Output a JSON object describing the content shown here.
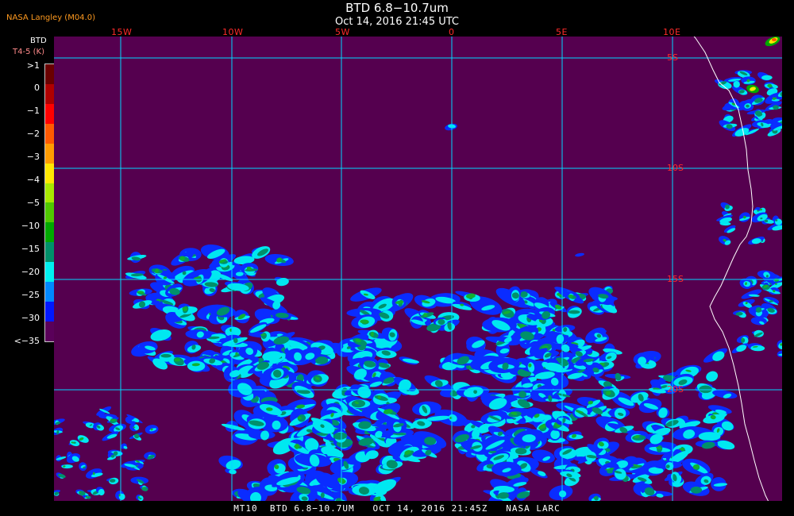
{
  "header": {
    "title": "BTD 6.8−10.7um",
    "subtitle": "Oct 14, 2016 21:45 UTC",
    "agency": "NASA Langley (M04.0)"
  },
  "colorbar": {
    "title_line1": "BTD",
    "title_line2": "T4-5 (K)",
    "labels": [
      ">1",
      "0",
      "−1",
      "−2",
      "−3",
      "−4",
      "−5",
      "−10",
      "−15",
      "−20",
      "−25",
      "−30",
      "<−35"
    ],
    "colors": [
      "#6a0000",
      "#b00000",
      "#ff0000",
      "#ff5a00",
      "#ff9c00",
      "#ffe800",
      "#a8e800",
      "#50c800",
      "#00a800",
      "#00906a",
      "#00f0f0",
      "#0088ff",
      "#0018ff",
      "#5a005a"
    ]
  },
  "map": {
    "background": "#55004f",
    "grid_color": "#00d8ff",
    "lon_labels": [
      "15W",
      "10W",
      "5W",
      "0",
      "5E",
      "10E"
    ],
    "lat_labels": [
      "5S",
      "10S",
      "15S",
      "20S"
    ],
    "lon_range": [
      -18,
      14.8
    ],
    "lat_range": [
      -4.0,
      -23.8
    ]
  },
  "footer": {
    "text": "MT10  BTD 6.8−10.7UM   OCT 14, 2016 21:45Z   NASA LARC"
  }
}
